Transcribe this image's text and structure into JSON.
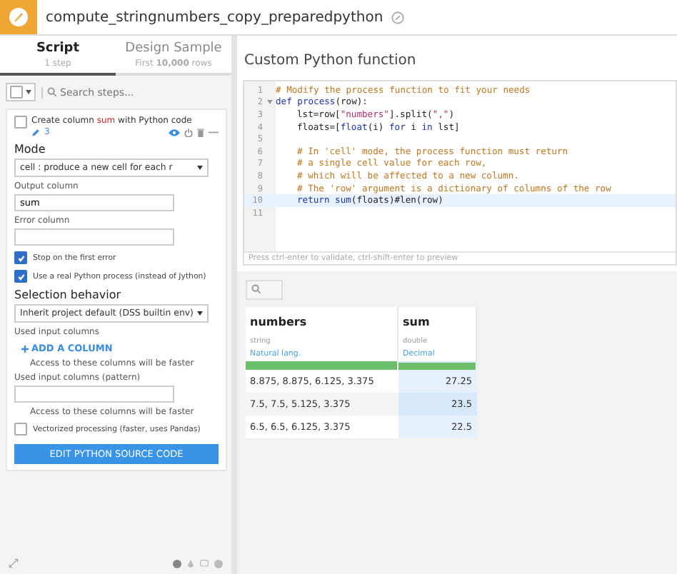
{
  "header": {
    "title": "compute_stringnumbers_copy_preparedpython"
  },
  "tabs": [
    {
      "label": "Script",
      "sub": "1 step",
      "selected": true
    },
    {
      "label": "Design Sample",
      "sub": "First **10,000** rows",
      "selected": false
    }
  ],
  "search": {
    "placeholder": "Search steps..."
  },
  "step": {
    "title_before": "Create column ",
    "title_highlight": "sum",
    "title_after": " with Python code",
    "edit_count": "3",
    "checked": false,
    "mode_label": "Mode",
    "mode_value": "cell : produce a new cell for each r",
    "output_label": "Output column",
    "output_value": "sum",
    "error_label": "Error column",
    "options": [
      {
        "label": "Stop on the first error",
        "checked": true
      },
      {
        "label": "Use a real Python process (instead of Jython)",
        "checked": true
      }
    ],
    "selection_label": "Selection behavior",
    "selection_value": "Inherit project default (DSS builtin env)",
    "used_label": "Used input columns",
    "add_label": "ADD A COLUMN",
    "hint1": "Access to these columns will be faster",
    "pattern_label": "Used input columns (pattern)",
    "hint2": "Access to these columns will be faster",
    "vectorized": {
      "label": "Vectorized processing (faster, uses Pandas)",
      "checked": false
    },
    "edit_button": "EDIT PYTHON SOURCE CODE"
  },
  "editor": {
    "title": "Custom Python function",
    "hint": "Press ctrl-enter to validate, ctrl-shift-enter to preview",
    "lines": [
      {
        "number": "1",
        "indented": false,
        "current": false,
        "foldable": false,
        "tokens": [
          {
            "kind": "comment",
            "text": "# Modify the process function to fit your needs"
          }
        ]
      },
      {
        "number": "2",
        "indented": false,
        "current": false,
        "foldable": true,
        "tokens": [
          {
            "kind": "keyword",
            "text": "def "
          },
          {
            "kind": "keyword",
            "text": "process"
          },
          {
            "kind": "plain",
            "text": "(row):"
          }
        ]
      },
      {
        "number": "3",
        "indented": true,
        "current": false,
        "foldable": false,
        "tokens": [
          {
            "kind": "plain",
            "text": "lst=row["
          },
          {
            "kind": "string",
            "text": "\"numbers\""
          },
          {
            "kind": "plain",
            "text": "].split("
          },
          {
            "kind": "string",
            "text": "\",\""
          },
          {
            "kind": "plain",
            "text": ")"
          }
        ]
      },
      {
        "number": "4",
        "indented": true,
        "current": false,
        "foldable": false,
        "tokens": [
          {
            "kind": "plain",
            "text": "floats=["
          },
          {
            "kind": "keyword",
            "text": "float"
          },
          {
            "kind": "plain",
            "text": "(i) "
          },
          {
            "kind": "keyword",
            "text": "for"
          },
          {
            "kind": "plain",
            "text": " i "
          },
          {
            "kind": "keyword",
            "text": "in"
          },
          {
            "kind": "plain",
            "text": " lst]"
          }
        ]
      },
      {
        "number": "5",
        "current": false,
        "foldable": false
      },
      {
        "number": "6",
        "indented": true,
        "current": false,
        "foldable": false,
        "tokens": [
          {
            "kind": "comment",
            "text": "# In 'cell' mode, the process function must return"
          }
        ]
      },
      {
        "number": "7",
        "indented": true,
        "current": false,
        "foldable": false,
        "tokens": [
          {
            "kind": "comment",
            "text": "# a single cell value for each row,"
          }
        ]
      },
      {
        "number": "8",
        "indented": true,
        "current": false,
        "foldable": false,
        "tokens": [
          {
            "kind": "comment",
            "text": "# which will be affected to a new column."
          }
        ]
      },
      {
        "number": "9",
        "indented": true,
        "current": false,
        "foldable": false,
        "tokens": [
          {
            "kind": "comment",
            "text": "# The 'row' argument is a dictionary of columns of the row"
          }
        ]
      },
      {
        "number": "10",
        "indented": true,
        "current": true,
        "foldable": false,
        "tokens": [
          {
            "kind": "keyword",
            "text": "return "
          },
          {
            "kind": "keyword",
            "text": "sum"
          },
          {
            "kind": "plain",
            "text": "(floats)#len(row)"
          }
        ]
      },
      {
        "number": "11",
        "current": false,
        "foldable": false
      }
    ]
  },
  "table": {
    "columns": [
      {
        "name": "numbers",
        "type": "string",
        "meaning": "Natural lang.",
        "new": false
      },
      {
        "name": "sum",
        "type": "double",
        "meaning": "Decimal",
        "new": true
      }
    ],
    "rows": [
      [
        "8.875, 8.875, 6.125, 3.375",
        "27.25"
      ],
      [
        "7.5, 7.5, 5.125, 3.375",
        "23.5"
      ],
      [
        "6.5, 6.5, 6.125, 3.375",
        "22.5"
      ]
    ]
  }
}
